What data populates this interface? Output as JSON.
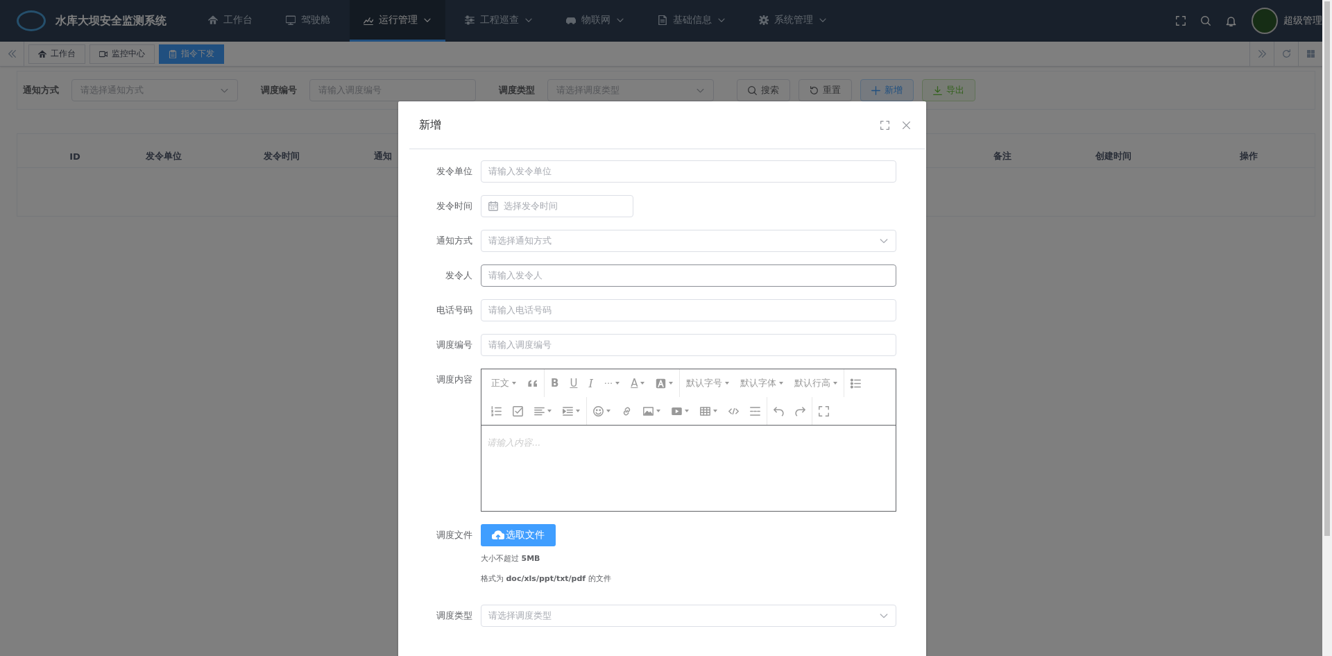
{
  "header": {
    "title": "水库大坝安全监测系统",
    "user": "超级管理",
    "menu": [
      {
        "label": "工作台",
        "selected": false,
        "has_submenu": false
      },
      {
        "label": "驾驶舱",
        "selected": false,
        "has_submenu": false
      },
      {
        "label": "运行管理",
        "selected": true,
        "has_submenu": true
      },
      {
        "label": "工程巡查",
        "selected": false,
        "has_submenu": true
      },
      {
        "label": "物联网",
        "selected": false,
        "has_submenu": true
      },
      {
        "label": "基础信息",
        "selected": false,
        "has_submenu": true
      },
      {
        "label": "系统管理",
        "selected": false,
        "has_submenu": true
      }
    ]
  },
  "tags": [
    {
      "label": "工作台",
      "selected": false
    },
    {
      "label": "监控中心",
      "selected": false
    },
    {
      "label": "指令下发",
      "selected": true
    }
  ],
  "filters": [
    {
      "label": "通知方式",
      "kind": "select",
      "placeholder": "请选择通知方式"
    },
    {
      "label": "调度编号",
      "kind": "input",
      "placeholder": "请输入调度编号"
    },
    {
      "label": "调度类型",
      "kind": "select",
      "placeholder": "请选择调度类型"
    }
  ],
  "filter_buttons": [
    {
      "label": "搜索",
      "kind": "search"
    },
    {
      "label": "重置",
      "kind": "reset"
    },
    {
      "label": "新增",
      "kind": "add"
    },
    {
      "label": "导出",
      "kind": "export"
    }
  ],
  "table": {
    "columns": [
      "ID",
      "发令单位",
      "发令时间",
      "通知",
      "备注",
      "创建时间",
      "操作"
    ]
  },
  "dialog": {
    "title": "新增",
    "fields": [
      {
        "label": "发令单位",
        "kind": "input",
        "placeholder": "请输入发令单位",
        "focused": false
      },
      {
        "label": "发令时间",
        "kind": "date",
        "placeholder": "选择发令时间",
        "focused": false
      },
      {
        "label": "通知方式",
        "kind": "select",
        "placeholder": "请选择通知方式",
        "focused": false
      },
      {
        "label": "发令人",
        "kind": "input",
        "placeholder": "请输入发令人",
        "focused": true
      },
      {
        "label": "电话号码",
        "kind": "input",
        "placeholder": "请输入电话号码",
        "focused": false
      },
      {
        "label": "调度编号",
        "kind": "input",
        "placeholder": "请输入调度编号",
        "focused": false
      },
      {
        "label": "调度内容",
        "kind": "editor",
        "placeholder": "请输入内容...",
        "focused": false
      },
      {
        "label": "调度文件",
        "kind": "upload",
        "button": "选取文件",
        "hints": [
          "大小不超过 **5MB**",
          "格式为 **doc/xls/ppt/txt/pdf** 的文件"
        ],
        "focused": false
      },
      {
        "label": "调度类型",
        "kind": "select",
        "placeholder": "请选择调度类型",
        "focused": false
      }
    ],
    "toolbar_texts": [
      "正文",
      "B",
      "U",
      "I",
      "···",
      "A",
      "默认字号",
      "默认字体",
      "默认行高"
    ]
  }
}
